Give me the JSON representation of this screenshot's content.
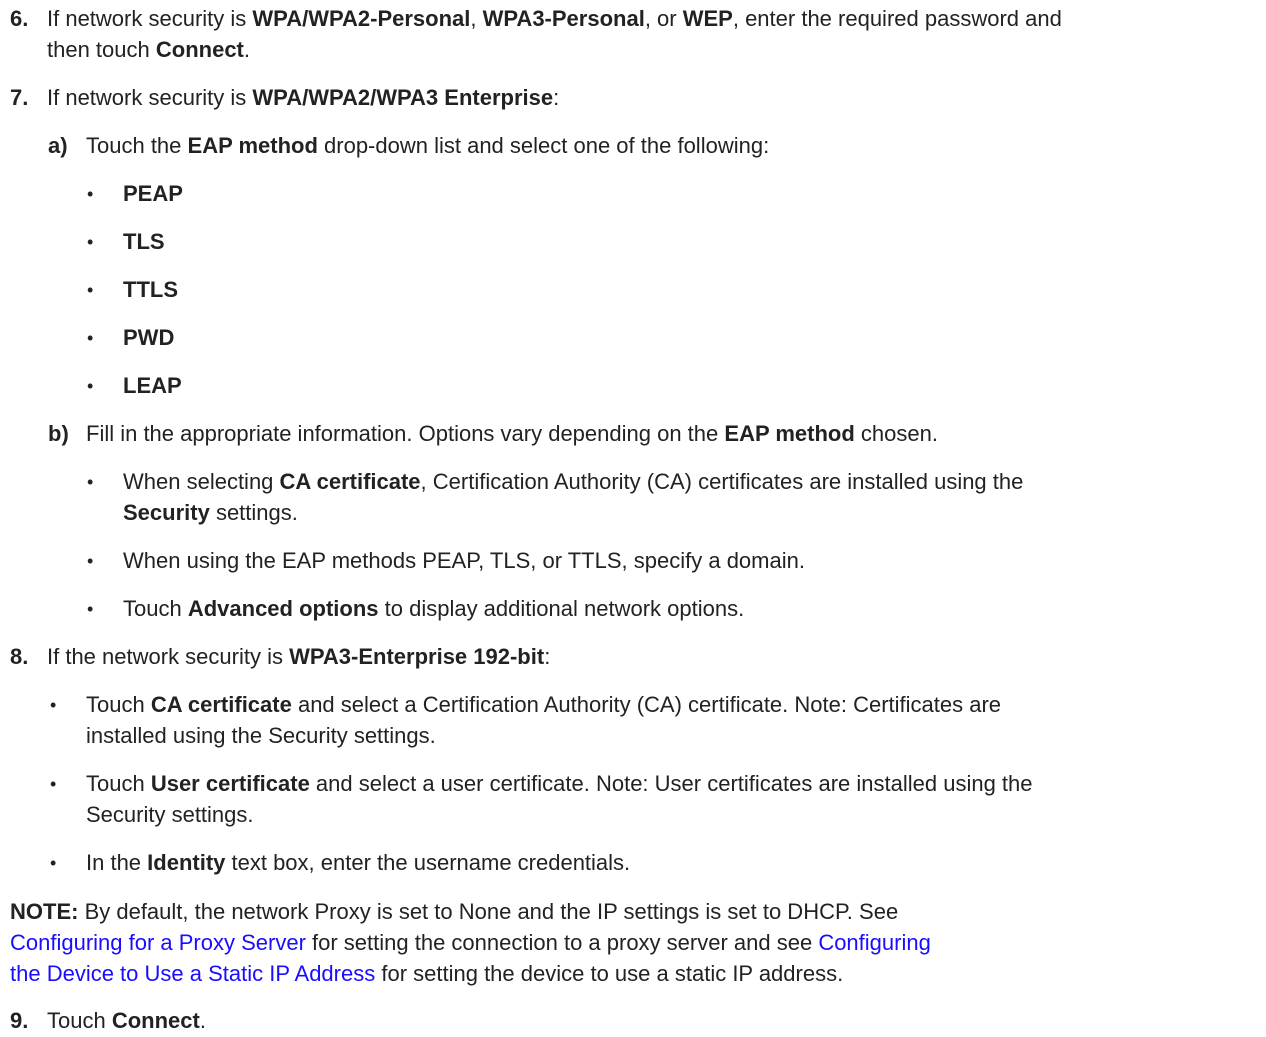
{
  "steps": {
    "s6": {
      "num": "6.",
      "t1": "If network security is ",
      "b1": "WPA/WPA2-Personal",
      "t2": ", ",
      "b2": "WPA3-Personal",
      "t3": ", or ",
      "b3": "WEP",
      "t4": ", enter the required password and",
      "t5": "then touch ",
      "b4": "Connect",
      "t6": "."
    },
    "s7": {
      "num": "7.",
      "t1": "If network security is ",
      "b1": "WPA/WPA2/WPA3 Enterprise",
      "t2": ":",
      "a": {
        "label": "a)",
        "t1": "Touch the ",
        "b1": "EAP method",
        "t2": " drop-down list and select one of the following:",
        "options": [
          "PEAP",
          "TLS",
          "TTLS",
          "PWD",
          "LEAP"
        ]
      },
      "b": {
        "label": "b)",
        "t1": "Fill in the appropriate information. Options vary depending on the ",
        "b1": "EAP method",
        "t2": " chosen.",
        "items": [
          {
            "t1": "When selecting ",
            "b1": "CA certificate",
            "t2": ", Certification Authority (CA) certificates are installed using the",
            "b2": "Security",
            "t3": " settings."
          },
          {
            "t1": "When using the EAP methods PEAP, TLS, or TTLS, specify a domain."
          },
          {
            "t1": "Touch ",
            "b1": "Advanced options",
            "t2": " to display additional network options."
          }
        ]
      }
    },
    "s8": {
      "num": "8.",
      "t1": "If the network security is ",
      "b1": "WPA3-Enterprise 192-bit",
      "t2": ":",
      "items": [
        {
          "t1": "Touch ",
          "b1": "CA certificate",
          "t2": " and select a Certification Authority (CA) certificate. Note: Certificates are",
          "t3": "installed using the Security settings."
        },
        {
          "t1": "Touch ",
          "b1": "User certificate",
          "t2": " and select a user certificate. Note: User certificates are installed using the",
          "t3": "Security settings."
        },
        {
          "t1": "In the ",
          "b1": "Identity",
          "t2": " text box, enter the username credentials."
        }
      ]
    },
    "note": {
      "label": "NOTE:",
      "t1": " By default, the network Proxy is set to None and the IP settings is set to DHCP. See",
      "link1": "Configuring for a Proxy Server",
      "t2": " for setting the connection to a proxy server and see ",
      "link2a": "Configuring",
      "link2b": "the Device to Use a Static IP Address",
      "t3": " for setting the device to use a static IP address."
    },
    "s9": {
      "num": "9.",
      "t1": "Touch ",
      "b1": "Connect",
      "t2": "."
    }
  },
  "colors": {
    "text": "#222222",
    "link": "#1a0dff"
  }
}
